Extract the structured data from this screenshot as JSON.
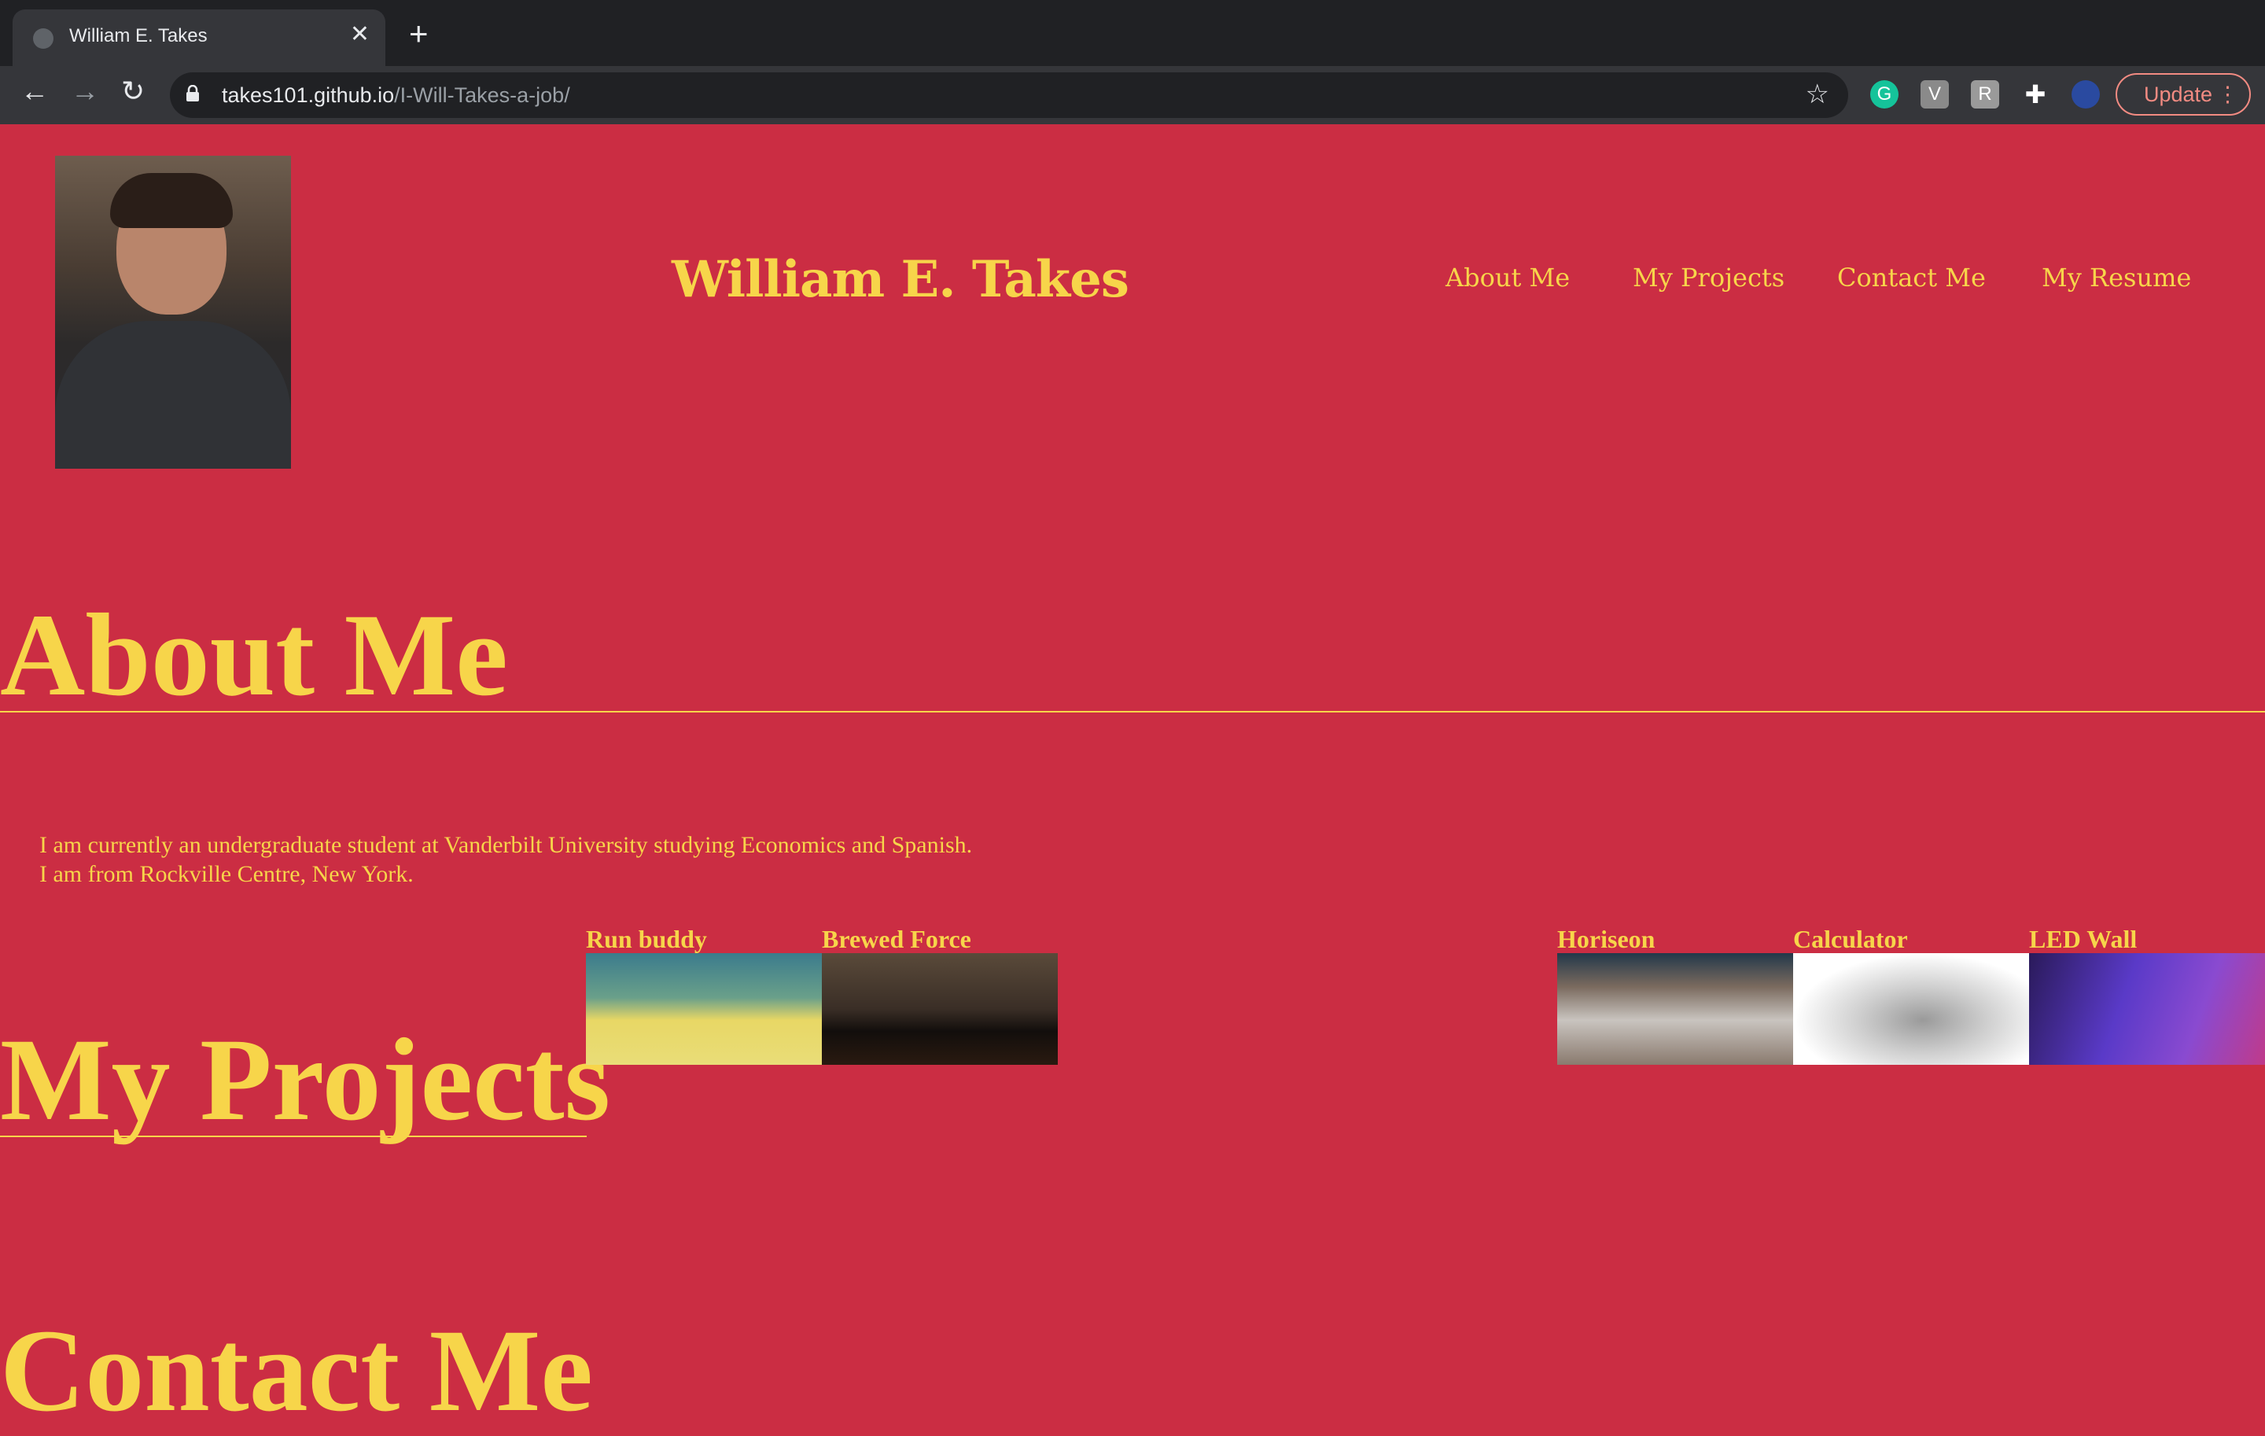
{
  "browser": {
    "tab_title": "William E. Takes",
    "url_host": "takes101.github.io",
    "url_path": "/I-Will-Takes-a-job/",
    "update_label": "Update"
  },
  "site": {
    "title": "William E. Takes",
    "nav": [
      "About Me",
      "My Projects",
      "Contact Me",
      "My Resume"
    ]
  },
  "about": {
    "heading": "About Me",
    "line1": "I am currently an undergraduate student at Vanderbilt University studying Economics and Spanish.",
    "line2": "I am from Rockville Centre, New York."
  },
  "projects": {
    "heading": "My Projects",
    "items": [
      "Run buddy",
      "Brewed Force",
      "Horiseon",
      "Calculator",
      "LED Wall"
    ]
  },
  "contact": {
    "heading": "Contact Me"
  },
  "colors": {
    "background": "#cb2d43",
    "accent": "#f7d54a"
  }
}
